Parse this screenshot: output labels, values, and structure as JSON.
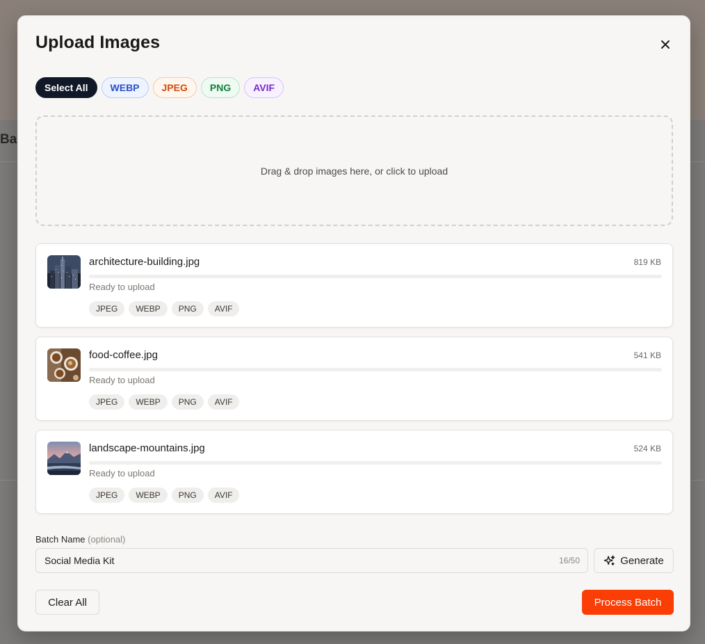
{
  "background": {
    "partial_heading": "Ba"
  },
  "modal": {
    "title": "Upload Images",
    "close_icon": "close-icon",
    "filters": [
      {
        "label": "Select All",
        "key": "all"
      },
      {
        "label": "WEBP",
        "key": "webp"
      },
      {
        "label": "JPEG",
        "key": "jpeg"
      },
      {
        "label": "PNG",
        "key": "png"
      },
      {
        "label": "AVIF",
        "key": "avif"
      }
    ],
    "dropzone": {
      "text": "Drag & drop images here, or click to upload"
    },
    "files": [
      {
        "name": "architecture-building.jpg",
        "size": "819 KB",
        "status": "Ready to upload",
        "progress": 0,
        "formats": [
          "JPEG",
          "WEBP",
          "PNG",
          "AVIF"
        ]
      },
      {
        "name": "food-coffee.jpg",
        "size": "541 KB",
        "status": "Ready to upload",
        "progress": 0,
        "formats": [
          "JPEG",
          "WEBP",
          "PNG",
          "AVIF"
        ]
      },
      {
        "name": "landscape-mountains.jpg",
        "size": "524 KB",
        "status": "Ready to upload",
        "progress": 0,
        "formats": [
          "JPEG",
          "WEBP",
          "PNG",
          "AVIF"
        ]
      }
    ],
    "batch": {
      "label": "Batch Name",
      "optional": "(optional)",
      "value": "Social Media Kit",
      "char_count": "16/50",
      "generate_label": "Generate"
    },
    "footer": {
      "clear_label": "Clear All",
      "process_label": "Process Batch"
    }
  },
  "colors": {
    "primary": "#fb3d06",
    "select_all_bg": "#111827"
  }
}
